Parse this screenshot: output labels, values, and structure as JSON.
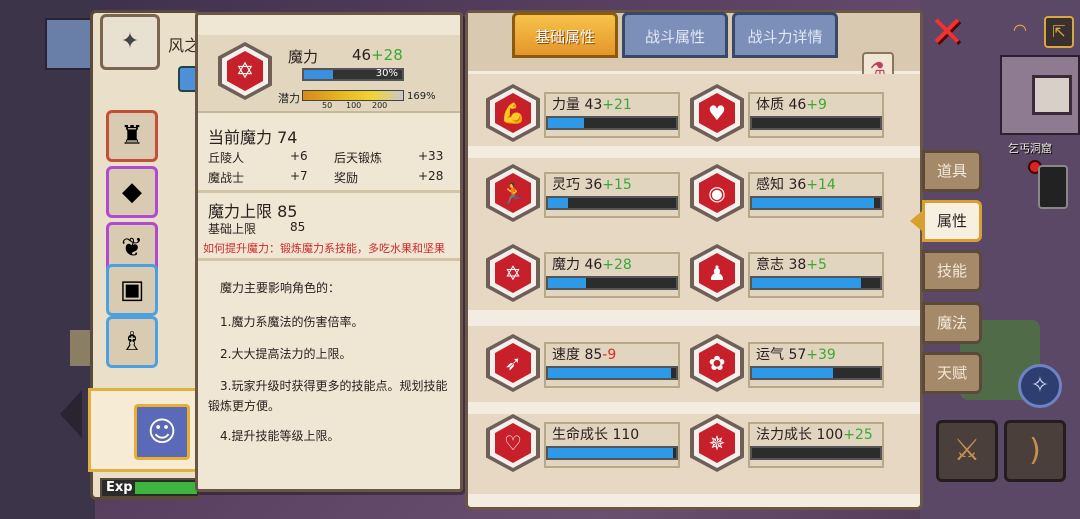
{
  "left_panel": {
    "name": "风之",
    "exp_label": "Exp"
  },
  "hud": {
    "minimap_label": "乞丐洞窟"
  },
  "tooltip": {
    "title": "魔力",
    "value": "46",
    "bonus": "+28",
    "bar_fraction": 0.3,
    "bar_label": "30%",
    "potential_label": "潜力",
    "potential_ticks": [
      "50",
      "100",
      "200"
    ],
    "potential_pct": "169%",
    "current_title": "当前魔力 74",
    "current_rows": [
      {
        "name": "丘陵人",
        "val": "+6",
        "name2": "后天锻炼",
        "val2": "+33"
      },
      {
        "name": "魔战士",
        "val": "+7",
        "name2": "奖励",
        "val2": "+28"
      }
    ],
    "cap_title": "魔力上限 85",
    "cap_base_label": "基础上限",
    "cap_base_value": "85",
    "hint": "如何提升魔力：锻炼魔力系技能，多吃水果和坚果",
    "desc_intro": "魔力主要影响角色的：",
    "desc_items": [
      "1.魔力系魔法的伤害倍率。",
      "2.大大提高法力的上限。",
      "3.玩家升级时获得更多的技能点。规划技能锻炼更方便。",
      "4.提升技能等级上限。"
    ]
  },
  "tabs": [
    "基础属性",
    "战斗属性",
    "战斗力详情"
  ],
  "attributes": [
    {
      "name": "力量",
      "value": "43",
      "bonus": "+21",
      "bonus_type": "plus",
      "fill": 0.28
    },
    {
      "name": "体质",
      "value": "46",
      "bonus": "+9",
      "bonus_type": "plus",
      "fill": 0.0
    },
    {
      "name": "灵巧",
      "value": "36",
      "bonus": "+15",
      "bonus_type": "plus",
      "fill": 0.16
    },
    {
      "name": "感知",
      "value": "36",
      "bonus": "+14",
      "bonus_type": "plus",
      "fill": 0.95
    },
    {
      "name": "魔力",
      "value": "46",
      "bonus": "+28",
      "bonus_type": "plus",
      "fill": 0.3
    },
    {
      "name": "意志",
      "value": "38",
      "bonus": "+5",
      "bonus_type": "plus",
      "fill": 0.85
    },
    {
      "name": "速度",
      "value": "85",
      "bonus": "-9",
      "bonus_type": "minus",
      "fill": 0.96
    },
    {
      "name": "运气",
      "value": "57",
      "bonus": "+39",
      "bonus_type": "plus",
      "fill": 0.63
    },
    {
      "name": "生命成长",
      "value": "110",
      "bonus": "",
      "bonus_type": "plus",
      "fill": 0.98
    },
    {
      "name": "法力成长",
      "value": "100",
      "bonus": "+25",
      "bonus_type": "plus",
      "fill": 0.0
    }
  ],
  "attr_icons": [
    "arm-muscle-icon",
    "body-muscle-icon",
    "running-man-icon",
    "eye-icon",
    "hexagram-icon",
    "head-silhouette-icon",
    "speed-wing-icon",
    "clover-icon",
    "heart-icon",
    "mana-figure-icon"
  ],
  "side_tabs": [
    "道具",
    "属性",
    "技能",
    "魔法",
    "天赋"
  ],
  "colors": {
    "hex_red": "#c8202a",
    "bar_blue": "#2c9ae8",
    "bonus_green": "#3aa832",
    "bonus_red": "#d82a2a",
    "tab_active": "#f0b040"
  }
}
